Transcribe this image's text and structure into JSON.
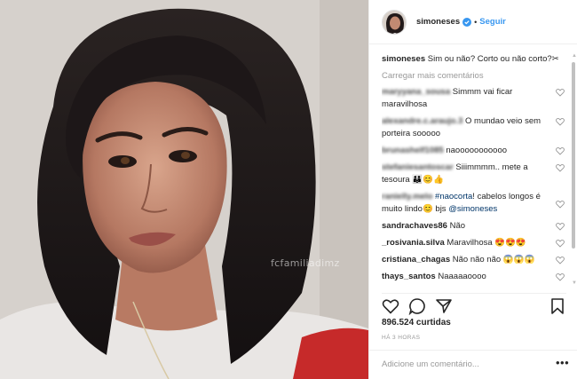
{
  "post": {
    "watermark": "fcfamiliadimz",
    "header": {
      "username": "simoneses",
      "separator": "•",
      "follow_label": "Seguir"
    },
    "caption": {
      "username": "simoneses",
      "text": " Sim ou não? Corto ou não corto?✂"
    },
    "load_more_label": "Carregar mais comentários",
    "comments": [
      {
        "user": "maryyana_sousa",
        "text": " Simmm vai ficar maravilhosa"
      },
      {
        "user": "alexandre.c.araujo.3",
        "text": " O mundao veio sem porteira sooooo"
      },
      {
        "user": "brunashelf1085",
        "text": " naooooooooooo"
      },
      {
        "user": "stefaniesantoscar",
        "text": " Siiimmmm.. mete a tesoura 👪😊👍"
      },
      {
        "user": "ranielly.melo",
        "hashtag": " #naocorta",
        "text": "! cabelos longos é muito lindo😊 bjs ",
        "mention": "@simoneses"
      },
      {
        "user": "sandrachaves86",
        "text": " Não"
      },
      {
        "user": "_rosivania.silva",
        "text": " Maravilhosa 😍😍😍"
      },
      {
        "user": "cristiana_chagas",
        "text": " Não não não 😱😱😱"
      },
      {
        "user": "thays_santos",
        "text": " Naaaaaoooo"
      }
    ],
    "likes_label": "896.524 curtidas",
    "time_label": "HÁ 3 HORAS",
    "add_comment_placeholder": "Adicione um comentário...",
    "more_label": "•••"
  },
  "colors": {
    "link_blue": "#3897f0",
    "text": "#262626",
    "muted": "#999999"
  },
  "icons": [
    "verified-badge-icon",
    "heart-icon",
    "comment-icon",
    "share-icon",
    "bookmark-icon"
  ]
}
